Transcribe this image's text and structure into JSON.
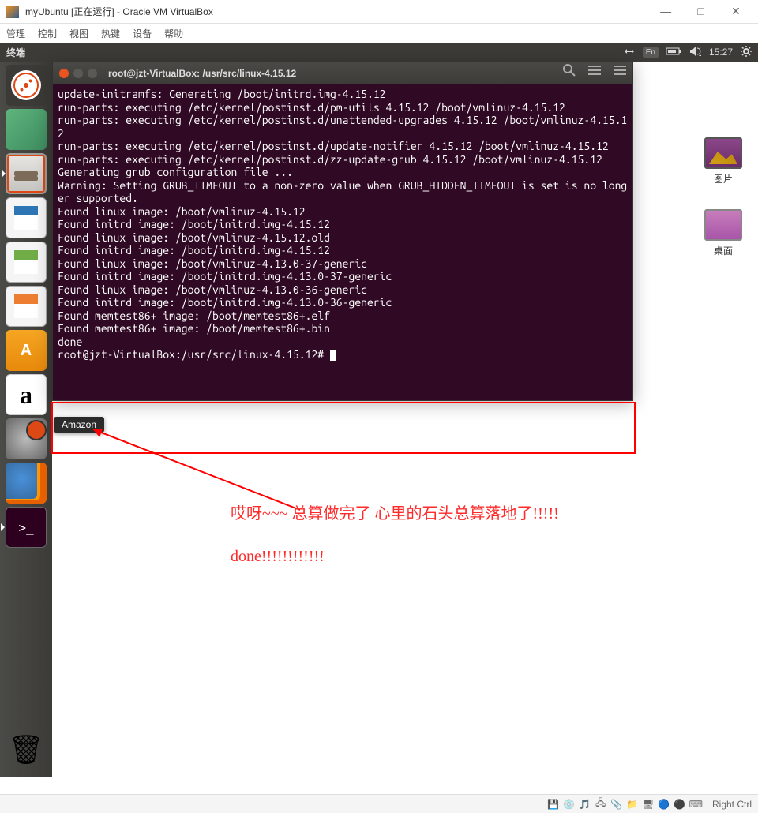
{
  "vbox": {
    "title": "myUbuntu [正在运行] - Oracle VM VirtualBox",
    "menus": [
      "管理",
      "控制",
      "视图",
      "热键",
      "设备",
      "帮助"
    ],
    "window_controls": {
      "min": "—",
      "max": "□",
      "close": "✕"
    },
    "status_icons": [
      "disk-icon",
      "cd-icon",
      "net-icon",
      "usb-icon",
      "shared-icon",
      "display-icon",
      "audio-icon",
      "capture-icon",
      "power-icon"
    ],
    "host_key": "Right Ctrl"
  },
  "ubuntu": {
    "panel_app": "终端",
    "lang": "En",
    "time": "15:27",
    "launcher": [
      {
        "name": "dash",
        "cls": "dash"
      },
      {
        "name": "atom",
        "cls": "atom-app"
      },
      {
        "name": "files",
        "cls": "files-app",
        "active": true
      },
      {
        "name": "writer",
        "cls": "writer-app"
      },
      {
        "name": "calc",
        "cls": "calc-app"
      },
      {
        "name": "impress",
        "cls": "impress-app"
      },
      {
        "name": "software",
        "cls": "software-app"
      },
      {
        "name": "amazon",
        "cls": "amazon-app"
      },
      {
        "name": "settings",
        "cls": "settings-app"
      },
      {
        "name": "firefox",
        "cls": "firefox-app"
      },
      {
        "name": "terminal",
        "cls": "terminal-app",
        "active": true
      }
    ],
    "tooltip": "Amazon",
    "desktop_icons": {
      "pictures": "图片",
      "desktop": "桌面"
    }
  },
  "terminal": {
    "title": "root@jzt-VirtualBox: /usr/src/linux-4.15.12",
    "lines": [
      "update-initramfs: Generating /boot/initrd.img-4.15.12",
      "run-parts: executing /etc/kernel/postinst.d/pm-utils 4.15.12 /boot/vmlinuz-4.15.12",
      "run-parts: executing /etc/kernel/postinst.d/unattended-upgrades 4.15.12 /boot/vmlinuz-4.15.12",
      "run-parts: executing /etc/kernel/postinst.d/update-notifier 4.15.12 /boot/vmlinuz-4.15.12",
      "run-parts: executing /etc/kernel/postinst.d/zz-update-grub 4.15.12 /boot/vmlinuz-4.15.12",
      "Generating grub configuration file ...",
      "Warning: Setting GRUB_TIMEOUT to a non-zero value when GRUB_HIDDEN_TIMEOUT is set is no longer supported.",
      "Found linux image: /boot/vmlinuz-4.15.12",
      "Found initrd image: /boot/initrd.img-4.15.12",
      "Found linux image: /boot/vmlinuz-4.15.12.old",
      "Found initrd image: /boot/initrd.img-4.15.12",
      "Found linux image: /boot/vmlinuz-4.13.0-37-generic",
      "Found initrd image: /boot/initrd.img-4.13.0-37-generic",
      "Found linux image: /boot/vmlinuz-4.13.0-36-generic",
      "Found initrd image: /boot/initrd.img-4.13.0-36-generic",
      "Found memtest86+ image: /boot/memtest86+.elf",
      "Found memtest86+ image: /boot/memtest86+.bin",
      "done"
    ],
    "prompt": "root@jzt-VirtualBox:/usr/src/linux-4.15.12# "
  },
  "annotations": {
    "line1": "哎呀~~~  总算做完了   心里的石头总算落地了!!!!!",
    "line2": "done!!!!!!!!!!!!"
  }
}
